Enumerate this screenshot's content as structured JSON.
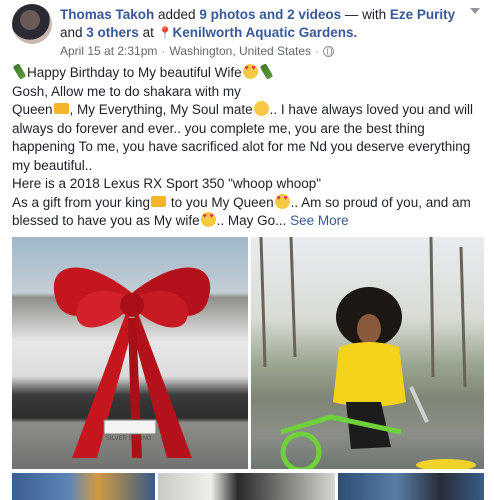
{
  "post": {
    "author": "Thomas Takoh",
    "action_pre": " added ",
    "photos_link": "9 photos and 2 videos",
    "action_mid": " — with ",
    "tagged_person": "Eze Purity",
    "and_text": " and ",
    "others_link": "3 others",
    "at_text": " at ",
    "location_link": "Kenilworth Aquatic Gardens.",
    "date": "April 15 at 2:31pm",
    "separator": "·",
    "place": "Washington, United States",
    "separator2": "·"
  },
  "text": {
    "line1": "Happy Birthday to My beautiful Wife",
    "line2": "Gosh, Allow me to do shakara with my",
    "line3a": "Queen",
    "line3b": ", My Everything, My Soul mate",
    "line3c": ".. I have always loved you and will always do forever and ever.. you complete me, you are the best thing happening To me, you have sacrificed alot for me Nd you deserve everything my beautiful..",
    "line4": "Here is a 2018 Lexus RX Sport 350 \"whoop whoop\"",
    "line5a": "As a gift from your king",
    "line5b": " to you My Queen",
    "line5c": ".. Am so proud of you, and am blessed to have you as My wife",
    "line5d": ".. May Go...",
    "see_more": "See More"
  },
  "media": {
    "license_plate": "SILVER SPRING"
  },
  "colors": {
    "link": "#385898",
    "meta": "#616770",
    "text": "#1d2129"
  }
}
